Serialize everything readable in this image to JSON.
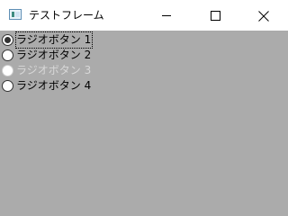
{
  "window": {
    "title": "テストフレーム"
  },
  "radios": [
    {
      "label": "ラジオボタン 1",
      "checked": true,
      "enabled": true,
      "focused": true
    },
    {
      "label": "ラジオボタン 2",
      "checked": false,
      "enabled": true,
      "focused": false
    },
    {
      "label": "ラジオボタン 3",
      "checked": false,
      "enabled": false,
      "focused": false
    },
    {
      "label": "ラジオボタン 4",
      "checked": false,
      "enabled": true,
      "focused": false
    }
  ],
  "colors": {
    "client_background": "#ababab",
    "titlebar_background": "#ffffff",
    "disabled_text": "#d8d8d8"
  },
  "icons": {
    "app": "app-window-icon",
    "minimize": "minimize-icon",
    "maximize": "maximize-icon",
    "close": "close-icon"
  }
}
